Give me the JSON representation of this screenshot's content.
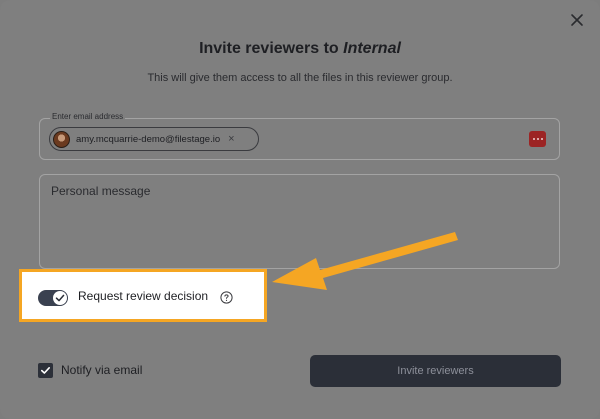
{
  "dialog": {
    "title_prefix": "Invite reviewers to ",
    "title_group": "Internal",
    "subtitle": "This will give them access to all the files in this reviewer group."
  },
  "email": {
    "label": "Enter email address",
    "chips": [
      {
        "email": "amy.mcquarrie-demo@filestage.io",
        "remove": "×"
      }
    ]
  },
  "message": {
    "placeholder": "Personal message"
  },
  "review_decision": {
    "label": "Request review decision",
    "enabled": true,
    "help_icon": "question-circle-icon"
  },
  "footer": {
    "notify_label": "Notify via email",
    "notify_checked": true,
    "invite_label": "Invite reviewers"
  },
  "colors": {
    "highlight": "#f5a623",
    "arrow": "#f5a623",
    "primary_button": "#2b2f38",
    "more_button": "#9c2424"
  }
}
